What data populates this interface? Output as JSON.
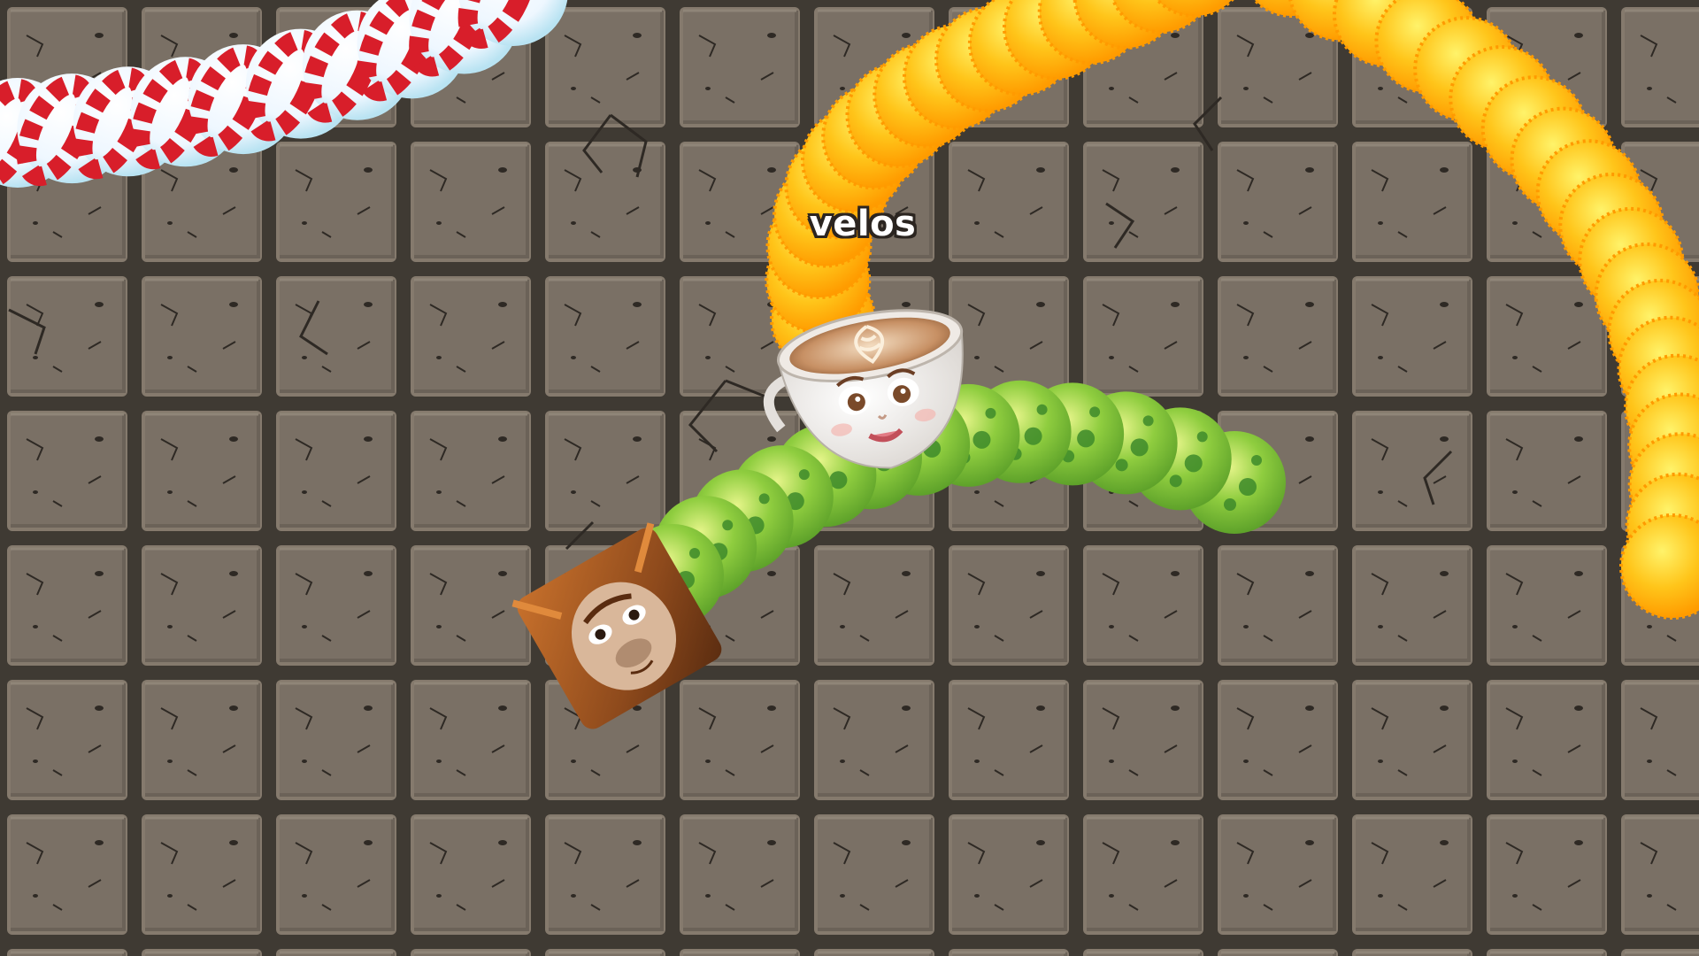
{
  "game": {
    "arena": {
      "floor_color": "#7a7065",
      "grout_color": "#3f3a33",
      "crack_color": "#2e2924"
    },
    "snakes": [
      {
        "id": "player",
        "name_label": "velos",
        "skin": "cappuccino-cup-face",
        "body_color": "#ffb400",
        "body_highlight": "#fff05a"
      },
      {
        "id": "enemy-green",
        "skin": "orangutan-face",
        "body_color": "#7cc23a",
        "body_highlight": "#d8f07a",
        "spot_color": "#3d8a2a"
      },
      {
        "id": "enemy-candy",
        "skin": "candy-cane-stripes",
        "body_color": "#e8f6ff",
        "stripe_color": "#d81e2a"
      },
      {
        "id": "enemy-orange-right",
        "skin": "orange-segments",
        "body_color": "#ffb400",
        "body_highlight": "#fff05a"
      }
    ]
  }
}
